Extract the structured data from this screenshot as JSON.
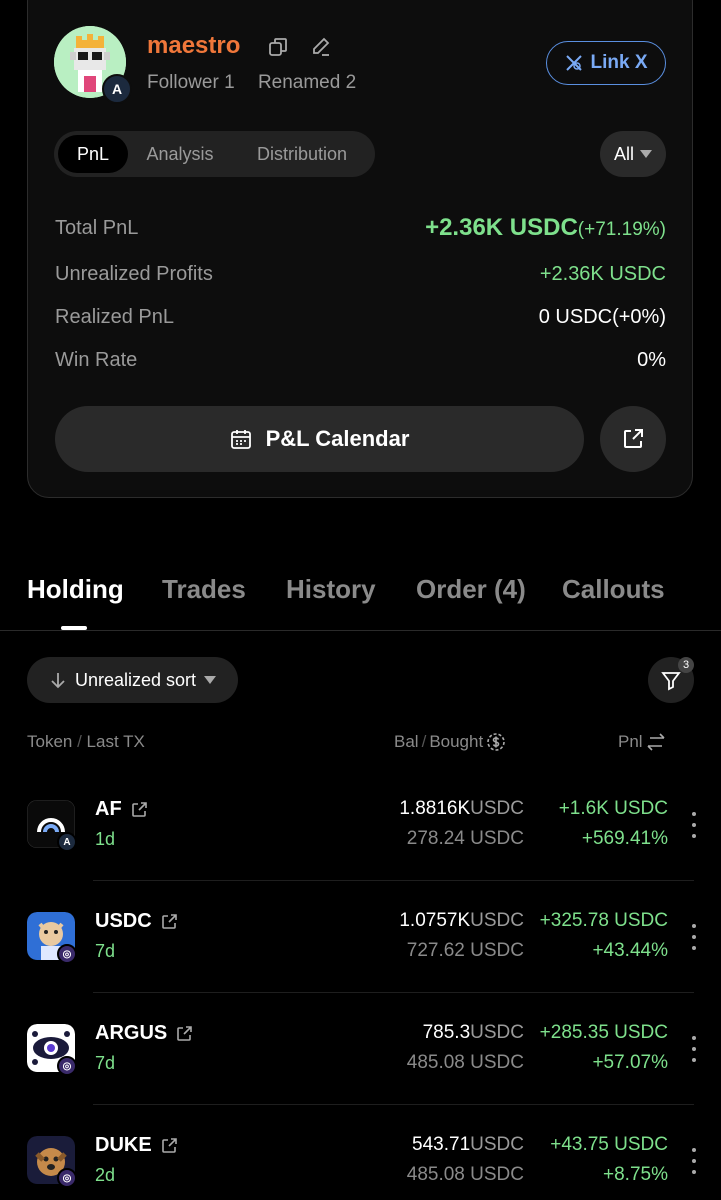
{
  "profile": {
    "username": "maestro",
    "follower": "Follower 1",
    "renamed": "Renamed 2",
    "avatar_badge": "A",
    "link_x_label": "Link X",
    "accent_color": "#f0773a"
  },
  "segments": [
    "PnL",
    "Analysis",
    "Distribution"
  ],
  "filter_all": "All",
  "stats": {
    "total_pnl_label": "Total PnL",
    "total_pnl_value": "+2.36K USDC",
    "total_pnl_pct": "(+71.19%)",
    "unrealized_label": "Unrealized Profits",
    "unrealized_value": "+2.36K USDC",
    "realized_label": "Realized PnL",
    "realized_value": "0 USDC",
    "realized_pct": "(+0%)",
    "winrate_label": "Win Rate",
    "winrate_value": "0%"
  },
  "calendar_label": "P&L Calendar",
  "tabs": [
    "Holding",
    "Trades",
    "History",
    "Order (4)",
    "Callouts"
  ],
  "sort_label": "Unrealized sort",
  "filter_count": "3",
  "columns": {
    "token": "Token",
    "last_tx": "Last TX",
    "bal": "Bal",
    "bought": "Bought",
    "pnl": "Pnl"
  },
  "tokens": [
    {
      "name": "AF",
      "age": "1d",
      "bal": "1.8816K",
      "bal_unit": "USDC",
      "bought": "278.24 USDC",
      "pnl": "+1.6K USDC",
      "pnl_pct": "+569.41%"
    },
    {
      "name": "USDC",
      "age": "7d",
      "bal": "1.0757K",
      "bal_unit": "USDC",
      "bought": "727.62 USDC",
      "pnl": "+325.78 USDC",
      "pnl_pct": "+43.44%"
    },
    {
      "name": "ARGUS",
      "age": "7d",
      "bal": "785.3",
      "bal_unit": "USDC",
      "bought": "485.08 USDC",
      "pnl": "+285.35 USDC",
      "pnl_pct": "+57.07%"
    },
    {
      "name": "DUKE",
      "age": "2d",
      "bal": "543.71",
      "bal_unit": "USDC",
      "bought": "485.08 USDC",
      "pnl": "+43.75 USDC",
      "pnl_pct": "+8.75%"
    }
  ]
}
